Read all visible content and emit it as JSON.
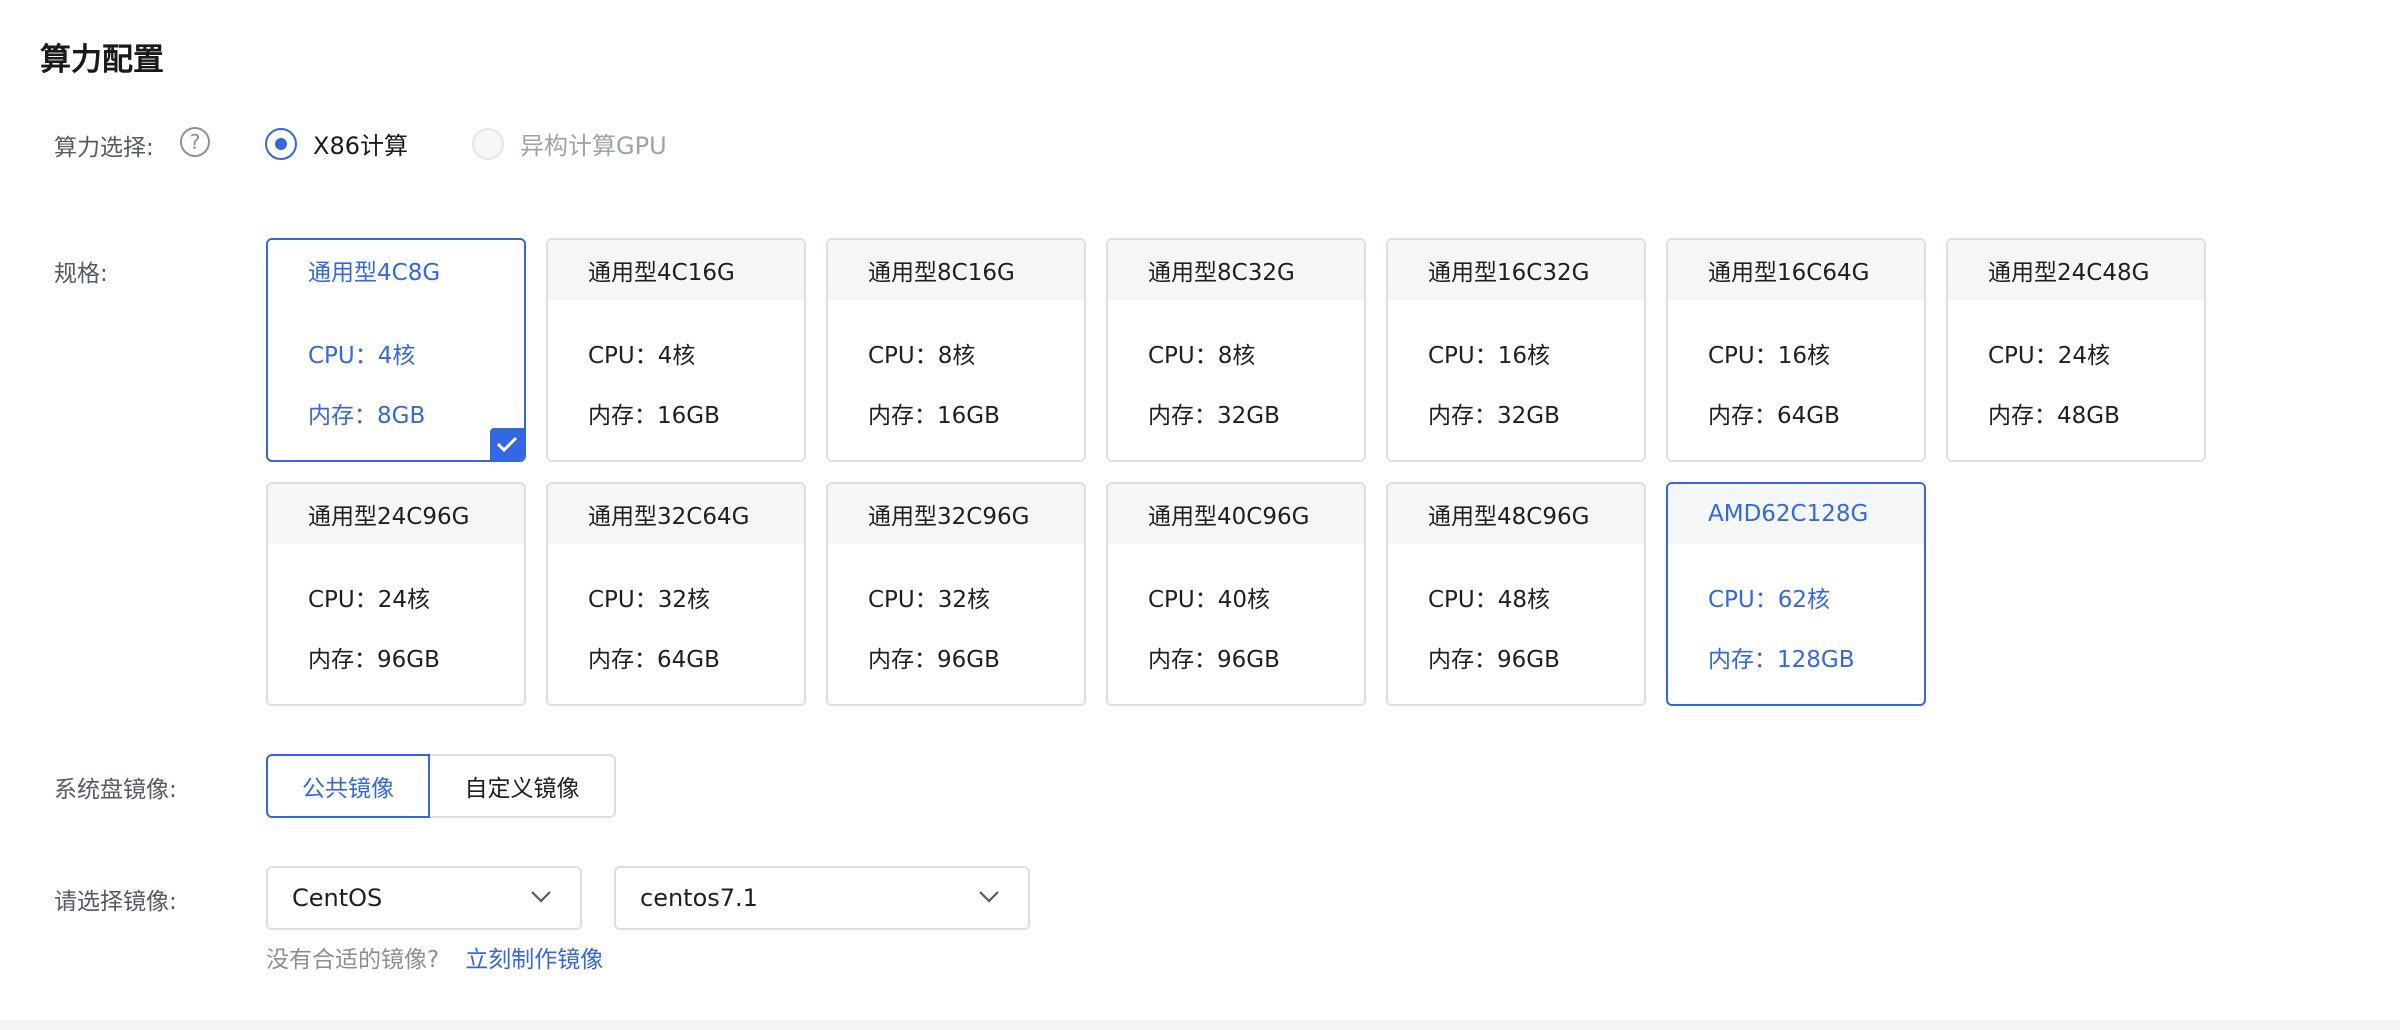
{
  "section": {
    "title": "算力配置"
  },
  "compute": {
    "label": "算力选择:",
    "help_icon": "question-circle-icon",
    "options": [
      {
        "label": "X86计算",
        "checked": true
      },
      {
        "label": "异构计算GPU",
        "checked": false,
        "disabled": true
      }
    ]
  },
  "specs": {
    "label": "规格:",
    "cpu_prefix": "CPU：",
    "mem_prefix": "内存：",
    "items": [
      {
        "name": "通用型4C8G",
        "cpu": "CPU：4核",
        "mem": "内存：8GB",
        "state": "selected"
      },
      {
        "name": "通用型4C16G",
        "cpu": "CPU：4核",
        "mem": "内存：16GB",
        "state": "normal"
      },
      {
        "name": "通用型8C16G",
        "cpu": "CPU：8核",
        "mem": "内存：16GB",
        "state": "normal"
      },
      {
        "name": "通用型8C32G",
        "cpu": "CPU：8核",
        "mem": "内存：32GB",
        "state": "normal"
      },
      {
        "name": "通用型16C32G",
        "cpu": "CPU：16核",
        "mem": "内存：32GB",
        "state": "normal"
      },
      {
        "name": "通用型16C64G",
        "cpu": "CPU：16核",
        "mem": "内存：64GB",
        "state": "normal"
      },
      {
        "name": "通用型24C48G",
        "cpu": "CPU：24核",
        "mem": "内存：48GB",
        "state": "normal"
      },
      {
        "name": "通用型24C96G",
        "cpu": "CPU：24核",
        "mem": "内存：96GB",
        "state": "normal"
      },
      {
        "name": "通用型32C64G",
        "cpu": "CPU：32核",
        "mem": "内存：64GB",
        "state": "normal"
      },
      {
        "name": "通用型32C96G",
        "cpu": "CPU：32核",
        "mem": "内存：96GB",
        "state": "normal"
      },
      {
        "name": "通用型40C96G",
        "cpu": "CPU：40核",
        "mem": "内存：96GB",
        "state": "normal"
      },
      {
        "name": "通用型48C96G",
        "cpu": "CPU：48核",
        "mem": "内存：96GB",
        "state": "normal"
      },
      {
        "name": "AMD62C128G",
        "cpu": "CPU：62核",
        "mem": "内存：128GB",
        "state": "highlight"
      }
    ]
  },
  "image_source": {
    "label": "系统盘镜像:",
    "tabs": [
      {
        "label": "公共镜像",
        "active": true
      },
      {
        "label": "自定义镜像",
        "active": false
      }
    ]
  },
  "image_select": {
    "label": "请选择镜像:",
    "os_value": "CentOS",
    "version_value": "centos7.1",
    "hint": "没有合适的镜像?",
    "link": "立刻制作镜像"
  },
  "colors": {
    "accent": "#3567e0",
    "border": "#dcdee2",
    "header_bg": "#f5f6f8"
  }
}
